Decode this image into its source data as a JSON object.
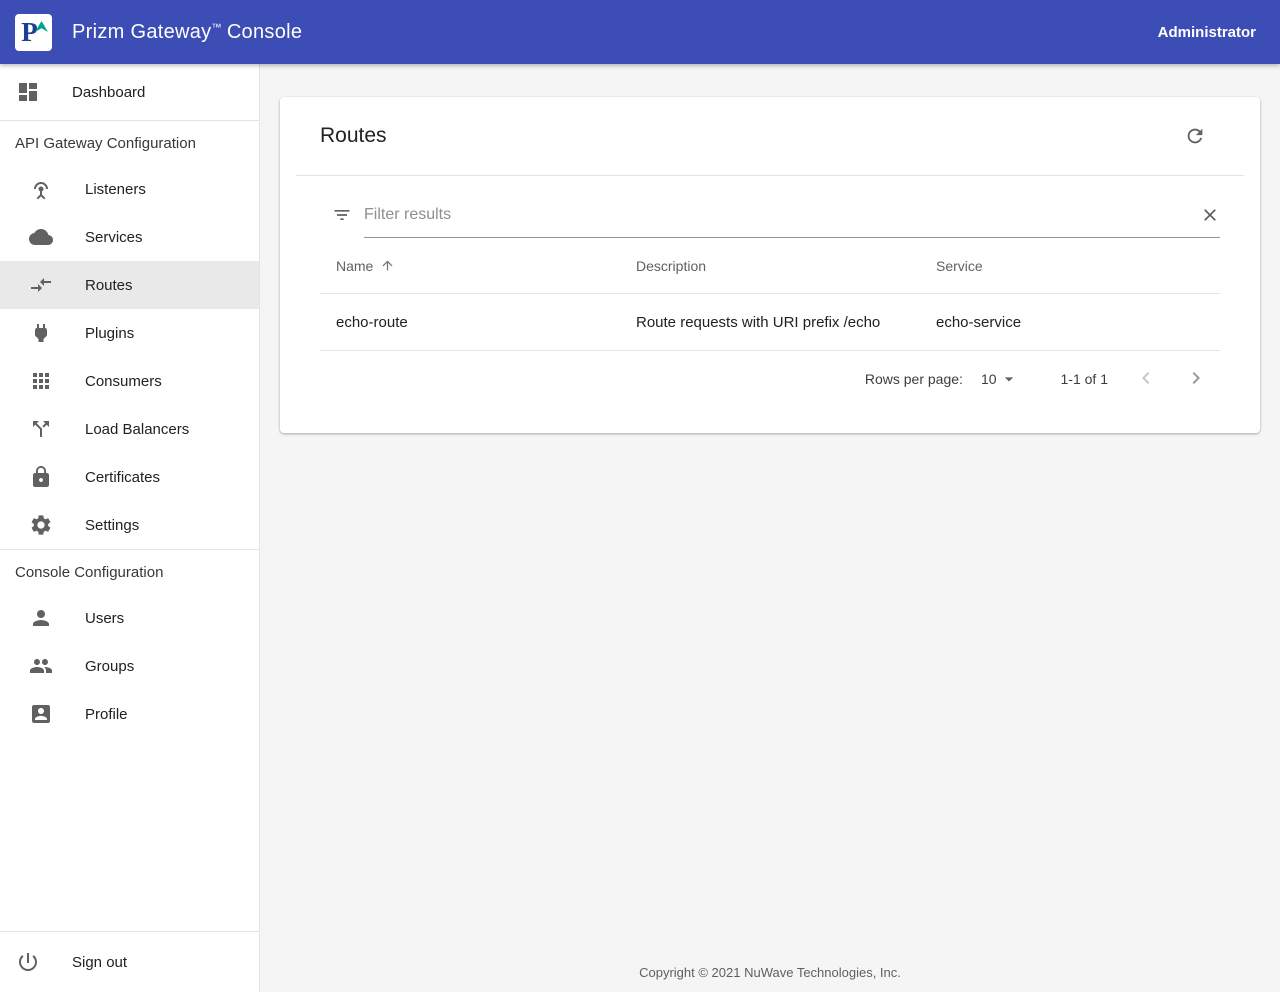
{
  "header": {
    "logo_letter": "P",
    "title_main": "Prizm Gateway",
    "title_tm": "™",
    "title_suffix": "Console",
    "user": "Administrator"
  },
  "sidebar": {
    "dashboard": {
      "label": "Dashboard",
      "icon": "dashboard-icon"
    },
    "section1": {
      "title": "API Gateway Configuration",
      "items": [
        {
          "label": "Listeners",
          "icon": "antenna-icon",
          "selected": false
        },
        {
          "label": "Services",
          "icon": "cloud-icon",
          "selected": false
        },
        {
          "label": "Routes",
          "icon": "compare-arrows-icon",
          "selected": true
        },
        {
          "label": "Plugins",
          "icon": "plug-icon",
          "selected": false
        },
        {
          "label": "Consumers",
          "icon": "apps-grid-icon",
          "selected": false
        },
        {
          "label": "Load Balancers",
          "icon": "call-split-icon",
          "selected": false
        },
        {
          "label": "Certificates",
          "icon": "lock-icon",
          "selected": false
        },
        {
          "label": "Settings",
          "icon": "gear-icon",
          "selected": false
        }
      ]
    },
    "section2": {
      "title": "Console Configuration",
      "items": [
        {
          "label": "Users",
          "icon": "person-icon"
        },
        {
          "label": "Groups",
          "icon": "people-icon"
        },
        {
          "label": "Profile",
          "icon": "contact-card-icon"
        }
      ]
    },
    "signout": {
      "label": "Sign out",
      "icon": "power-icon"
    }
  },
  "main": {
    "card": {
      "title": "Routes",
      "refresh_icon": "refresh-icon",
      "filter": {
        "placeholder": "Filter results",
        "filter_icon": "filter-icon",
        "clear_icon": "close-icon"
      },
      "table": {
        "columns": [
          "Name",
          "Description",
          "Service"
        ],
        "sort": {
          "column": "Name",
          "direction": "asc"
        },
        "rows": [
          {
            "name": "echo-route",
            "description": "Route requests with URI prefix /echo",
            "service": "echo-service"
          }
        ]
      },
      "pagination": {
        "rows_per_page_label": "Rows per page:",
        "rows_per_page_value": "10",
        "range": "1-1 of 1"
      }
    },
    "footer": "Copyright © 2021 NuWave Technologies, Inc."
  },
  "colors": {
    "header_bg": "#3c4db5",
    "content_bg": "#f5f5f5",
    "card_bg": "#ffffff",
    "selected_bg": "#e9e9e9",
    "divider": "#e4e4e4",
    "icon_gray": "#616161",
    "text_primary": "#212121",
    "text_secondary": "#616161",
    "logo_navy": "#1c3f94",
    "logo_teal": "#00a18e"
  }
}
